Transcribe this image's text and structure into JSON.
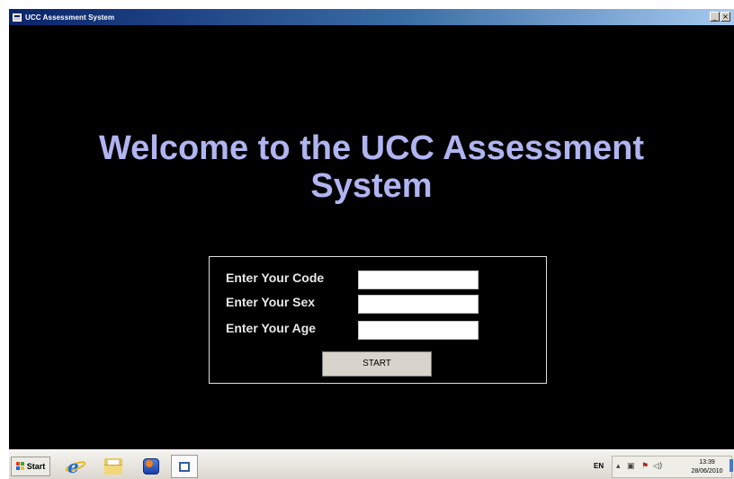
{
  "window": {
    "title": "UCC Assessment System",
    "controls": [
      "_",
      "×"
    ]
  },
  "main": {
    "welcome_line1": "Welcome to the UCC Assessment",
    "welcome_line2": "System",
    "form": {
      "code_label": "Enter Your Code",
      "sex_label": "Enter Your Sex",
      "age_label": "Enter Your Age",
      "code_value": "",
      "sex_value": "",
      "age_value": "",
      "start_label": "START"
    }
  },
  "taskbar": {
    "start_label": "Start",
    "language": "EN",
    "time": "13:39",
    "date": "28/06/2010"
  },
  "colors": {
    "background": "#000000",
    "heading": "#b0b4f0",
    "label": "#e8e8e8"
  }
}
